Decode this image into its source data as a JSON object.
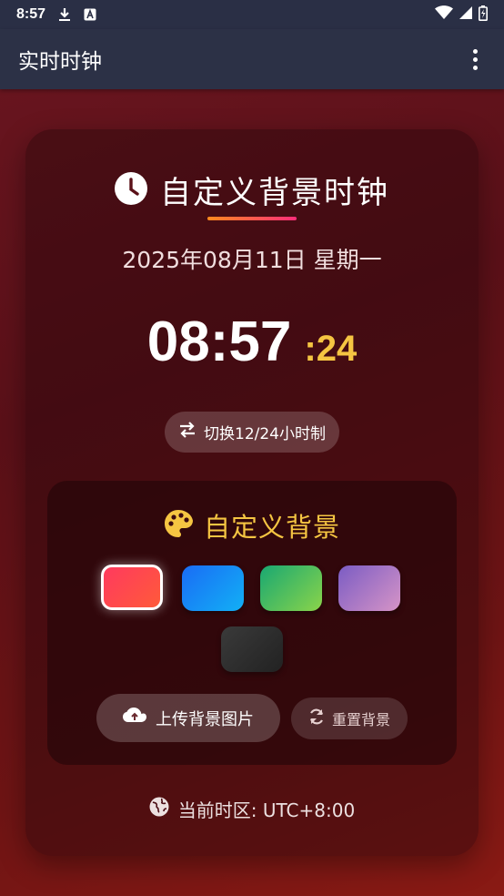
{
  "status_bar": {
    "time": "8:57",
    "icons": [
      "download-icon",
      "text-a-icon",
      "wifi-icon",
      "signal-icon",
      "battery-icon"
    ]
  },
  "app_bar": {
    "title": "实时时钟",
    "menu_icon": "more-vert-icon"
  },
  "clock": {
    "title": "自定义背景时钟",
    "title_icon": "clock-icon",
    "date": "2025年08月11日 星期一",
    "hours_minutes": "08:57",
    "seconds": ":24",
    "toggle_label": "切换12/24小时制",
    "toggle_icon": "swap-icon"
  },
  "background": {
    "title": "自定义背景",
    "title_icon": "palette-icon",
    "swatches": [
      {
        "name": "red",
        "selected": true
      },
      {
        "name": "blue",
        "selected": false
      },
      {
        "name": "green",
        "selected": false
      },
      {
        "name": "purple",
        "selected": false
      },
      {
        "name": "dark",
        "selected": false
      }
    ],
    "upload_label": "上传背景图片",
    "upload_icon": "cloud-upload-icon",
    "reset_label": "重置背景",
    "reset_icon": "refresh-icon"
  },
  "timezone": {
    "label": "当前时区: UTC+8:00",
    "icon": "globe-icon"
  },
  "colors": {
    "accent": "#f5c542",
    "underline_start": "#ff8a1e",
    "underline_end": "#ff2d7a",
    "app_bar": "#2c3146"
  }
}
